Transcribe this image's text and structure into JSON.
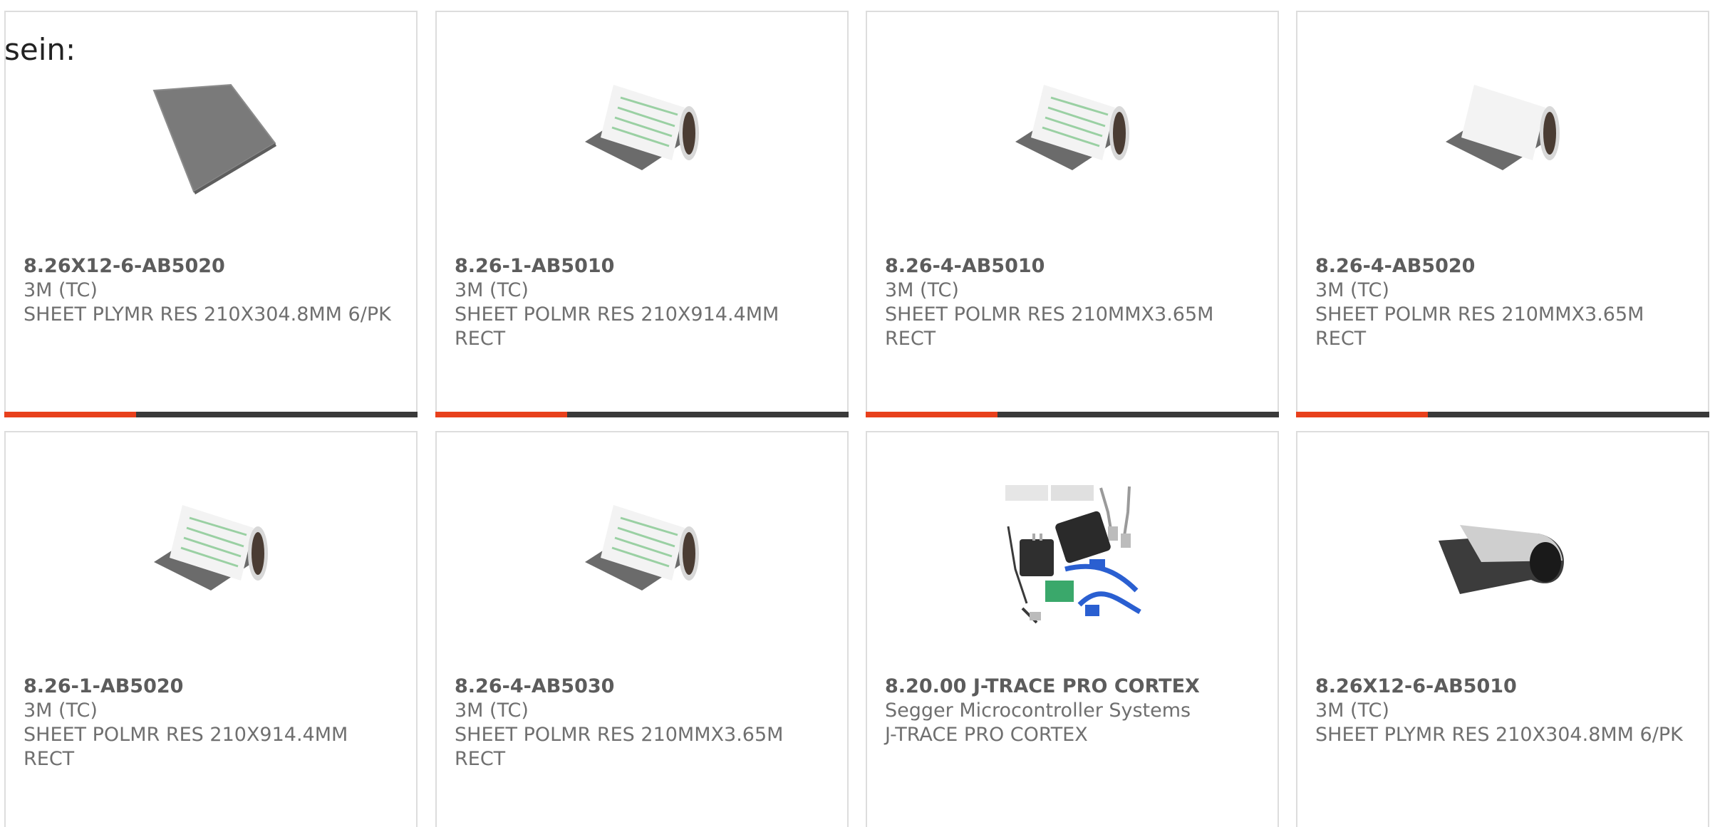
{
  "heading": "sein:",
  "colors": {
    "accent": "#e8401c",
    "bar": "#3a3a3a",
    "border": "#dddddd",
    "text": "#6f6f6f"
  },
  "products": [
    {
      "part": "8.26X12-6-AB5020",
      "manufacturer": "3M (TC)",
      "description": "SHEET PLYMR RES 210X304.8MM 6/PK",
      "image": "flat-sheet"
    },
    {
      "part": "8.26-1-AB5010",
      "manufacturer": "3M (TC)",
      "description": "SHEET POLMR RES 210X914.4MM RECT",
      "image": "rolled-sheet"
    },
    {
      "part": "8.26-4-AB5010",
      "manufacturer": "3M (TC)",
      "description": "SHEET POLMR RES 210MMX3.65M RECT",
      "image": "rolled-sheet"
    },
    {
      "part": "8.26-4-AB5020",
      "manufacturer": "3M (TC)",
      "description": "SHEET POLMR RES 210MMX3.65M RECT",
      "image": "rolled-sheet"
    },
    {
      "part": "8.26-1-AB5020",
      "manufacturer": "3M (TC)",
      "description": "SHEET POLMR RES 210X914.4MM RECT",
      "image": "rolled-sheet"
    },
    {
      "part": "8.26-4-AB5030",
      "manufacturer": "3M (TC)",
      "description": "SHEET POLMR RES 210MMX3.65M RECT",
      "image": "rolled-sheet"
    },
    {
      "part": "8.20.00 J-TRACE PRO CORTEX",
      "manufacturer": "Segger Microcontroller Systems",
      "description": "J-TRACE PRO CORTEX",
      "image": "debug-probe-kit"
    },
    {
      "part": "8.26X12-6-AB5010",
      "manufacturer": "3M (TC)",
      "description": "SHEET PLYMR RES 210X304.8MM 6/PK",
      "image": "curled-sheet"
    }
  ]
}
